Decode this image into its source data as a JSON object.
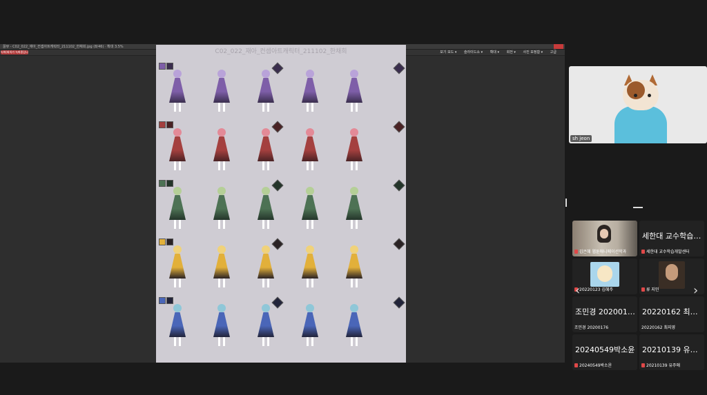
{
  "viewer": {
    "window_title": "꿀뷰 - C02_022_재아_컨셉아트캐릭터_211102_한채희.jpg (8/46) · 확대 3.5%",
    "sheet_title": "C02_022_재아_컨셉아트캐릭터_211102_한채희",
    "record_label": "녹화(회의가 녹화중입니다)",
    "menu_items": [
      "보기 모드 ▾",
      "슬라이드쇼 ▾",
      "확대 ▾",
      "회전 ▾",
      "사진 보정함 ▾",
      "고급"
    ]
  },
  "rows": [
    {
      "label": "purple",
      "color": "#7e5ea8",
      "dark": "#3a2d4d",
      "hair": "#b9a3d9"
    },
    {
      "label": "red",
      "color": "#a4403f",
      "dark": "#4a2224",
      "hair": "#e38a97"
    },
    {
      "label": "green",
      "color": "#4d7254",
      "dark": "#24352a",
      "hair": "#b5cf97"
    },
    {
      "label": "yellow",
      "color": "#e2b03a",
      "dark": "#2a2224",
      "hair": "#f0d27a"
    },
    {
      "label": "blue",
      "color": "#4a66b8",
      "dark": "#22243a",
      "hair": "#8fc7d8"
    }
  ],
  "self_video": {
    "name": "sh jeon"
  },
  "participants": [
    {
      "big_name": "",
      "label": "김은혜 웹툰애니메이션학과",
      "has_video": true
    },
    {
      "big_name": "세한대 교수학습개발센터",
      "label": "세한대 교수학습개발센터",
      "has_video": false
    },
    {
      "big_name": "",
      "label": "20220123 김혜주",
      "has_video": true
    },
    {
      "big_name": "",
      "label": "류 지민",
      "has_video": true
    },
    {
      "big_name": "조민경 20200176",
      "label": "조민경 20200176",
      "has_video": false
    },
    {
      "big_name": "20220162 최지영",
      "label": "20220162 최지영",
      "has_video": false
    },
    {
      "big_name": "20240549박소윤",
      "label": "20240549박소윤",
      "has_video": false
    },
    {
      "big_name": "20210139 유주애",
      "label": "20210139 유주애",
      "has_video": false
    }
  ],
  "nav": {
    "prev": "‹",
    "next": "›"
  }
}
